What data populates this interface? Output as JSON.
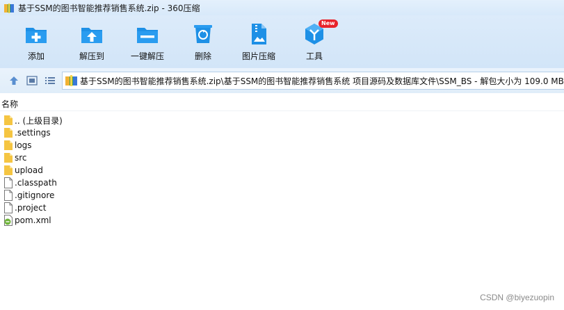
{
  "window": {
    "title": "基于SSM的图书智能推荐销售系统.zip - 360压缩"
  },
  "toolbar": {
    "add_label": "添加",
    "extract_label": "解压到",
    "oneclick_label": "一键解压",
    "delete_label": "删除",
    "image_compress_label": "图片压缩",
    "tools_label": "工具",
    "new_badge": "New"
  },
  "address": {
    "path": "基于SSM的图书智能推荐销售系统.zip\\基于SSM的图书智能推荐销售系统 项目源码及数据库文件\\SSM_BS - 解包大小为 109.0 MB"
  },
  "list": {
    "column_name": "名称",
    "items": [
      {
        "name": ".. (上级目录)",
        "type": "folder"
      },
      {
        "name": ".settings",
        "type": "folder"
      },
      {
        "name": "logs",
        "type": "folder"
      },
      {
        "name": "src",
        "type": "folder"
      },
      {
        "name": "upload",
        "type": "folder"
      },
      {
        "name": ".classpath",
        "type": "file"
      },
      {
        "name": ".gitignore",
        "type": "file"
      },
      {
        "name": ".project",
        "type": "file"
      },
      {
        "name": "pom.xml",
        "type": "xml"
      }
    ]
  },
  "watermark": "CSDN @biyezuopin",
  "colors": {
    "accent": "#1e90e6",
    "folder": "#f5c542",
    "badge": "#e8232b"
  }
}
